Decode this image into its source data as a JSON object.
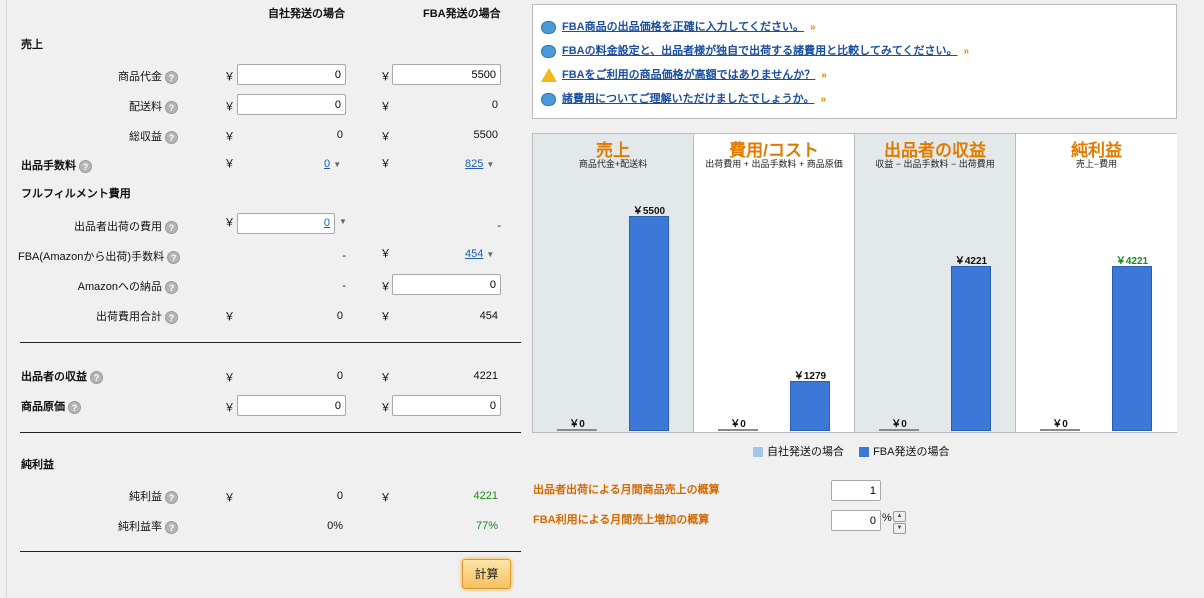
{
  "columns": {
    "self": "自社発送の場合",
    "fba": "FBA発送の場合"
  },
  "sections": {
    "sales": "売上",
    "fulfillment": "フルフィルメント費用",
    "net": "純利益"
  },
  "rows": {
    "product_price": {
      "label": "商品代金",
      "self": "0",
      "fba": "5500"
    },
    "shipping_fee": {
      "label": "配送料",
      "self": "0",
      "fba": "0"
    },
    "total_revenue": {
      "label": "総収益",
      "self": "0",
      "fba": "5500"
    },
    "selling_fee": {
      "label": "出品手数料",
      "self": "0",
      "fba": "825"
    },
    "seller_ship_cost": {
      "label": "出品者出荷の費用",
      "self": "0",
      "fba": "-"
    },
    "fba_fee": {
      "label": "FBA(Amazonから出荷)手数料",
      "self": "-",
      "fba": "454"
    },
    "amazon_inbound": {
      "label": "Amazonへの納品",
      "self": "-",
      "fba": "0"
    },
    "ship_total": {
      "label": "出荷費用合計",
      "self": "0",
      "fba": "454"
    },
    "seller_proceeds": {
      "label": "出品者の収益",
      "self": "0",
      "fba": "4221"
    },
    "cost_of_goods": {
      "label": "商品原価",
      "self": "0",
      "fba": "0"
    },
    "net_profit": {
      "label": "純利益",
      "self": "0",
      "fba": "4221"
    },
    "net_margin": {
      "label": "純利益率",
      "self": "0%",
      "fba": "77%"
    }
  },
  "yen": "￥",
  "help_icon": "?",
  "calc_button": "計算",
  "tips": [
    "FBA商品の出品価格を正確に入力してください。",
    "FBAの料金設定と、出品者様が独自で出荷する諸費用と比較してみてください。",
    "FBAをご利用の商品価格が高額ではありませんか？",
    "諸費用についてご理解いただけましたでしょうか。"
  ],
  "chevron": "»",
  "chart_data": {
    "type": "bar",
    "categories": [
      "売上",
      "費用/コスト",
      "出品者の収益",
      "純利益"
    ],
    "subtitles": [
      "商品代金+配送料",
      "出荷費用 + 出品手数料 + 商品原価",
      "収益 − 出品手数料 − 出荷費用",
      "売上−費用"
    ],
    "series": [
      {
        "name": "自社発送の場合",
        "values": [
          0,
          0,
          0,
          0
        ],
        "labels": [
          "￥0",
          "￥0",
          "￥0",
          "￥0"
        ],
        "color": "#a9c4ea"
      },
      {
        "name": "FBA発送の場合",
        "values": [
          5500,
          1279,
          4221,
          4221
        ],
        "labels": [
          "￥5500",
          "￥1279",
          "￥4221",
          "￥4221"
        ],
        "color": "#3b78d8"
      }
    ],
    "ylim": [
      0,
      5500
    ]
  },
  "monthly": {
    "seller_sales_label": "出品者出荷による月間商品売上の概算",
    "seller_sales_value": "1",
    "fba_increase_label": "FBA利用による月間売上増加の概算",
    "fba_increase_value": "0",
    "percent": "%"
  },
  "colors": {
    "accent_orange": "#e07b00",
    "bar_blue": "#3b78d8",
    "profit_green": "#1a8a1a",
    "link_blue": "#1a5fb4"
  }
}
